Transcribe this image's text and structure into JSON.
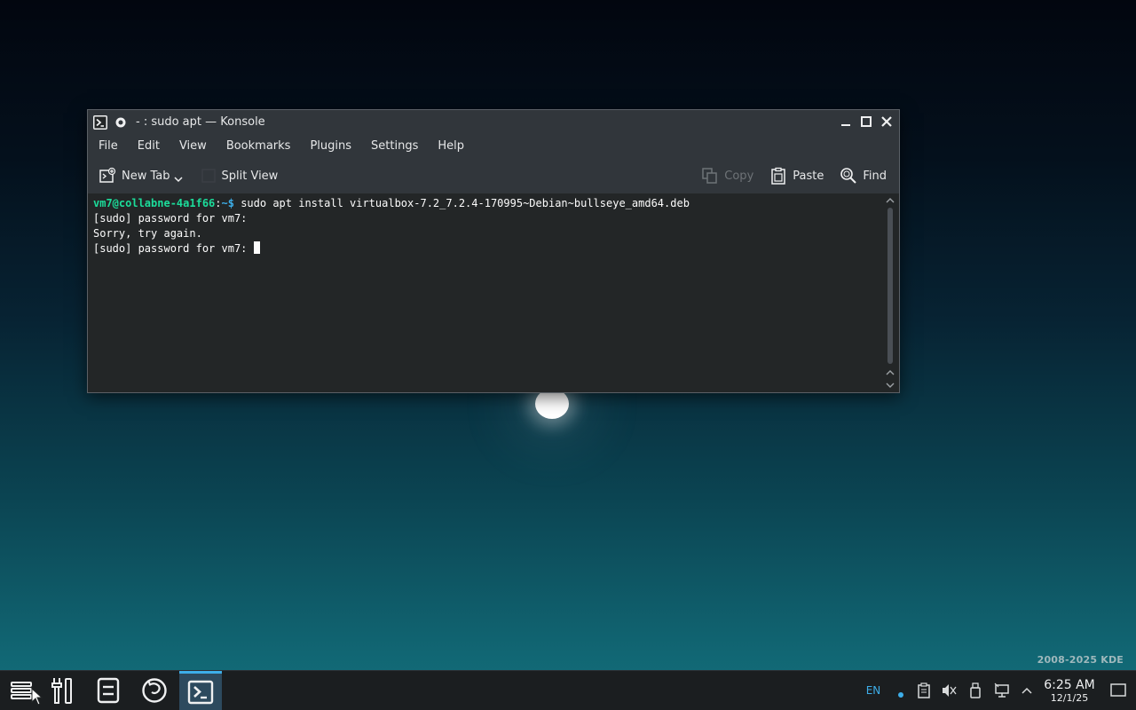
{
  "window": {
    "title": "- : sudo apt — Konsole",
    "menu": [
      "File",
      "Edit",
      "View",
      "Bookmarks",
      "Plugins",
      "Settings",
      "Help"
    ],
    "toolbar": {
      "new_tab": "New Tab",
      "split_view": "Split View",
      "copy": "Copy",
      "paste": "Paste",
      "find": "Find"
    },
    "terminal": {
      "prompt_user_host": "vm7@collabne-4a1f66",
      "prompt_sep": ":",
      "prompt_path": "~$",
      "command": " sudo apt install virtualbox-7.2_7.2.4-170995~Debian~bullseye_amd64.deb",
      "lines": [
        "[sudo] password for vm7:",
        "Sorry, try again.",
        "[sudo] password for vm7: "
      ]
    }
  },
  "desktop": {
    "watermark": "2008-2025 KDE"
  },
  "taskbar": {
    "tray": {
      "language": "EN",
      "time": "6:25 AM",
      "date": "12/1/25"
    }
  },
  "colors": {
    "accent": "#3daee9",
    "prompt_user": "#1cdc9a",
    "terminal_bg": "#232627"
  }
}
